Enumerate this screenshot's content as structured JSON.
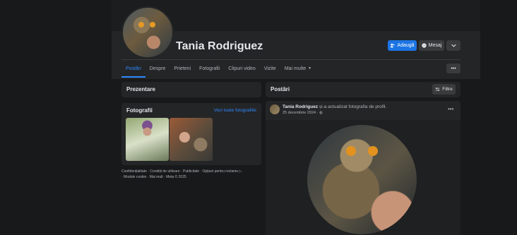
{
  "profile": {
    "name": "Tania Rodriguez",
    "add_label": "Adaugă",
    "message_label": "Mesaj"
  },
  "nav": {
    "tabs": [
      "Postări",
      "Despre",
      "Prieteni",
      "Fotografii",
      "Clipuri video",
      "Vizite",
      "Mai multe"
    ],
    "active": "Postări"
  },
  "intro": {
    "title": "Prezentare"
  },
  "photos": {
    "title": "Fotografii",
    "see_all": "Vezi toate fotografiile"
  },
  "footer": {
    "line1": "Confidențialitate · Condiții de utilizare · Publicitate · Opțiuni pentru reclame ▷",
    "line2": "· Module cookie · Mai mult · Meta © 2025"
  },
  "posts": {
    "title": "Postări",
    "filter_label": "Filtre",
    "post": {
      "author": "Tania Rodriguez",
      "action": "și-a actualizat fotografia de profil.",
      "date": "25 decembrie 2024 ·"
    }
  },
  "colors": {
    "accent": "#2d88ff",
    "button_primary": "#1b74e4",
    "background": "#18191a",
    "card": "#242526"
  }
}
